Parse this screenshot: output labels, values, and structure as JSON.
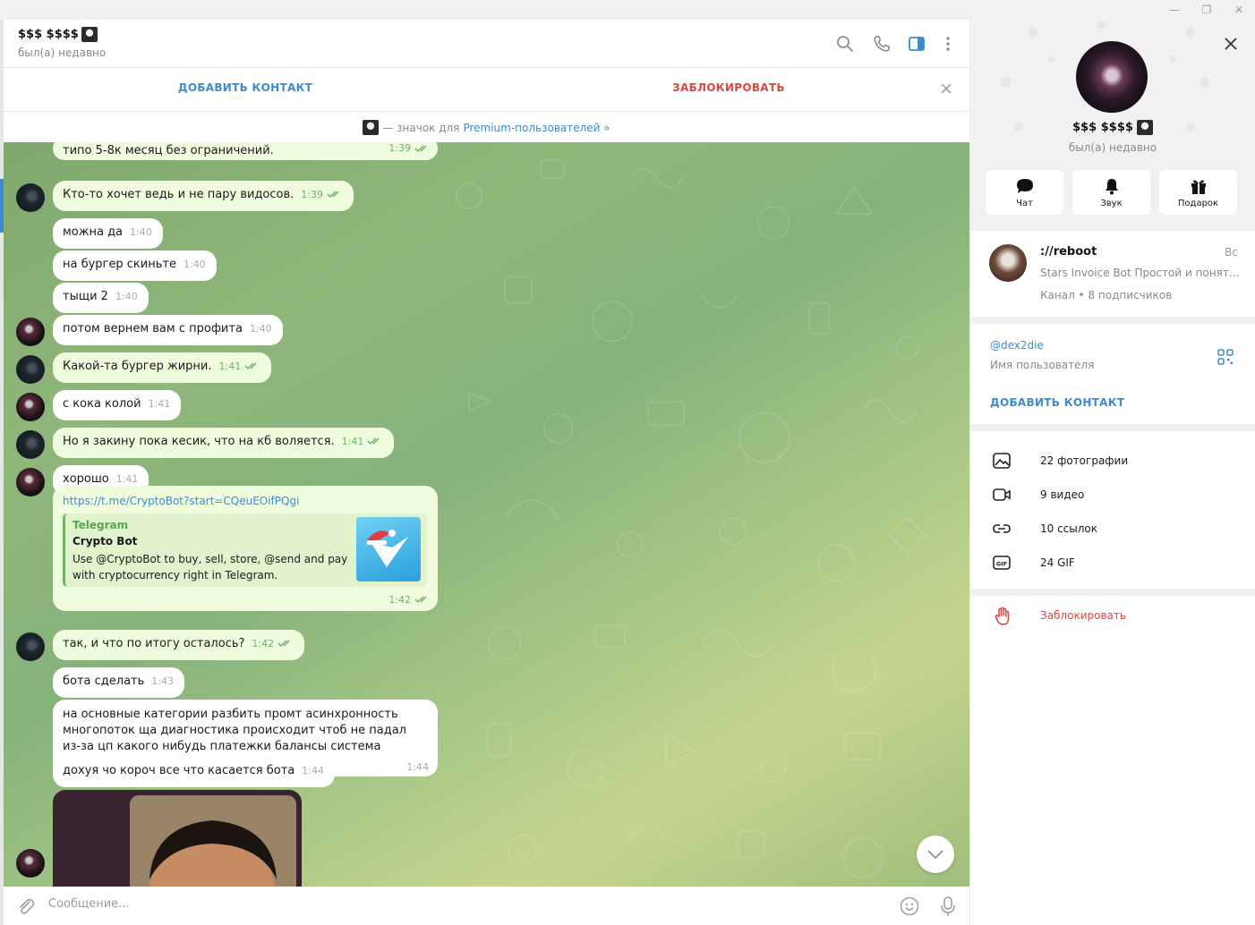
{
  "chat": {
    "title": "$$$ $$$$",
    "status": "был(а) недавно",
    "actions": {
      "add_contact": "ДОБАВИТЬ КОНТАКТ",
      "block": "ЗАБЛОКИРОВАТЬ"
    },
    "premium": {
      "text": "— значок для",
      "link": "Premium-пользователей »"
    },
    "messages": [
      {
        "text": "типо 5-8к месяц без ограничений.",
        "time": "1:39",
        "own": true
      },
      {
        "text": "Кто-то хочет ведь и не пару видосов.",
        "time": "1:39",
        "own": true
      },
      {
        "text": "можна да",
        "time": "1:40",
        "own": false
      },
      {
        "text": "на бургер скиньте",
        "time": "1:40",
        "own": false
      },
      {
        "text": "тыщи 2",
        "time": "1:40",
        "own": false
      },
      {
        "text": "потом вернем вам с профита",
        "time": "1:40",
        "own": false
      },
      {
        "text": "Какой-та бургер жирни.",
        "time": "1:41",
        "own": true
      },
      {
        "text": "с кока колой",
        "time": "1:41",
        "own": false
      },
      {
        "text": "Но я закину пока кесик, что на кб воляется.",
        "time": "1:41",
        "own": true
      },
      {
        "text": "хорошо",
        "time": "1:41",
        "own": false
      },
      {
        "text": "так, и что по итогу осталось?",
        "time": "1:42",
        "own": true
      },
      {
        "text": "бота сделать",
        "time": "1:43",
        "own": false
      },
      {
        "text": "на основные категории разбить промт асинхронность многопоток ща диагностика происходит чтоб не падал из-за цп какого нибудь платежки балансы система юзеров рефералов",
        "time": "1:44",
        "own": false
      },
      {
        "text": "дохуя чо короч все что касается бота",
        "time": "1:44",
        "own": false
      }
    ],
    "link_message": {
      "url": "https://t.me/CryptoBot?start=CQeuEOifPQgi",
      "site": "Telegram",
      "title": "Crypto Bot",
      "description": "Use @CryptoBot to buy, sell, store, @send and pay with cryptocurrency right in Telegram.",
      "time": "1:42"
    },
    "composer": {
      "placeholder": "Сообщение..."
    }
  },
  "panel": {
    "name": "$$$ $$$$",
    "status": "был(а) недавно",
    "buttons": {
      "chat": "Чат",
      "sound": "Звук",
      "gift": "Подарок"
    },
    "channel": {
      "title": "://reboot",
      "day": "Вс",
      "last_message": "Stars Invoice Bot  Простой и понятный",
      "subscribers": "Канал • 8 подписчиков"
    },
    "username": "@dex2die",
    "username_label": "Имя пользователя",
    "add_contact": "ДОБАВИТЬ КОНТАКТ",
    "media": {
      "photos": "22 фотографии",
      "videos": "9 видео",
      "links": "10 ссылок",
      "gifs": "24 GIF"
    },
    "block": "Заблокировать"
  },
  "colors": {
    "accent": "#3a8bd2",
    "danger": "#e0453d",
    "own_bubble": "#effdde",
    "check": "#6cb164"
  },
  "icons": [
    "search-icon",
    "phone-icon",
    "sidebar-toggle-icon",
    "more-icon",
    "close-icon",
    "attach-icon",
    "emoji-icon",
    "microphone-icon",
    "chevron-down-icon",
    "chat-icon",
    "bell-icon",
    "gift-icon",
    "qr-icon",
    "photo-icon",
    "video-icon",
    "link-icon",
    "gif-icon",
    "hand-icon"
  ]
}
